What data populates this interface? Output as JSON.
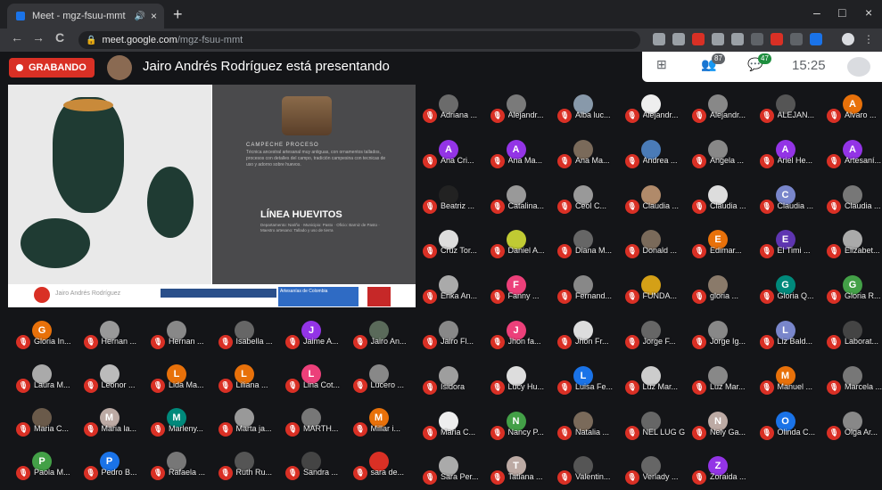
{
  "browser": {
    "tab_title": "Meet - mgz-fsuu-mmt",
    "tab_speaker": "🔊",
    "tab_close": "×",
    "new_tab": "+",
    "win_min": "–",
    "win_max": "□",
    "win_close": "×",
    "url_host": "meet.google.com",
    "url_path": "/mgz-fsuu-mmt",
    "nav_back": "←",
    "nav_forward": "→",
    "nav_reload": "C"
  },
  "meet": {
    "recording_label": "GRABANDO",
    "presenting_text": "Jairo Andrés Rodríguez está presentando",
    "participant_count": "87",
    "chat_count": "47",
    "time": "15:25",
    "grid_icon": "⊞",
    "people_icon": "👥",
    "chat_icon": "💬"
  },
  "slide": {
    "subtitle": "CAMPECHE PROCESO",
    "paragraph": "Técnica ancestral artesanal muy antiguas, con ornamentos tallados, procesos con detalles del campo, tradición campesina con tecnicas de uso y adorno sobre huevos.",
    "title": "LÍNEA HUEVITOS",
    "details": "Departamento: Nariño · Municipio: Pasto · Oficio: Barniz de Pasto · Maestro artesano: Tallado y uso de tierra",
    "footer_name": "Jairo Andrés Rodríguez",
    "footer_blue": "Artesanías de Colombia"
  },
  "participants_right": [
    {
      "name": "Adriana ...",
      "initial": "",
      "color": "#6b6b6b"
    },
    {
      "name": "Alejandr...",
      "initial": "",
      "color": "#7a7a7a"
    },
    {
      "name": "Alba luc...",
      "initial": "",
      "color": "#8899aa"
    },
    {
      "name": "Alejandr...",
      "initial": "",
      "color": "#eeeeee"
    },
    {
      "name": "Alejandr...",
      "initial": "",
      "color": "#888888"
    },
    {
      "name": "ALEJAN...",
      "initial": "",
      "color": "#555555"
    },
    {
      "name": "Alvaro ...",
      "initial": "A",
      "color": "#e8710a"
    },
    {
      "name": "Ana Cri...",
      "initial": "A",
      "color": "#9334e6"
    },
    {
      "name": "Ana Ma...",
      "initial": "A",
      "color": "#9334e6"
    },
    {
      "name": "Ana Ma...",
      "initial": "",
      "color": "#7a6a5a"
    },
    {
      "name": "Andrea ...",
      "initial": "",
      "color": "#4a7bb7"
    },
    {
      "name": "Angela ...",
      "initial": "",
      "color": "#888888"
    },
    {
      "name": "Ariel He...",
      "initial": "A",
      "color": "#9334e6"
    },
    {
      "name": "Artesaní...",
      "initial": "A",
      "color": "#9334e6"
    },
    {
      "name": "Beatriz ...",
      "initial": "",
      "color": "#222222"
    },
    {
      "name": "Catalina...",
      "initial": "",
      "color": "#999999"
    },
    {
      "name": "Ceol C...",
      "initial": "",
      "color": "#999999"
    },
    {
      "name": "Claudia ...",
      "initial": "",
      "color": "#b08a6a"
    },
    {
      "name": "Claudia ...",
      "initial": "",
      "color": "#dddddd"
    },
    {
      "name": "Claudia ...",
      "initial": "C",
      "color": "#7986cb"
    },
    {
      "name": "Claudia ...",
      "initial": "",
      "color": "#777777"
    },
    {
      "name": "Cruz Tor...",
      "initial": "",
      "color": "#dddddd"
    },
    {
      "name": "Daniel A...",
      "initial": "",
      "color": "#c0ca33"
    },
    {
      "name": "Diana M...",
      "initial": "",
      "color": "#666666"
    },
    {
      "name": "Donald ...",
      "initial": "",
      "color": "#7a6a5a"
    },
    {
      "name": "Edimar...",
      "initial": "E",
      "color": "#e8710a"
    },
    {
      "name": "El Timi ...",
      "initial": "E",
      "color": "#5e35b1"
    },
    {
      "name": "Elizabet...",
      "initial": "",
      "color": "#aaaaaa"
    },
    {
      "name": "Erika An...",
      "initial": "",
      "color": "#aaaaaa"
    },
    {
      "name": "Fanny ...",
      "initial": "F",
      "color": "#ec407a"
    },
    {
      "name": "Fernand...",
      "initial": "",
      "color": "#888888"
    },
    {
      "name": "FUNDA...",
      "initial": "",
      "color": "#d4a017"
    },
    {
      "name": "gloria ...",
      "initial": "",
      "color": "#8a7a6a"
    },
    {
      "name": "Gloria Q...",
      "initial": "G",
      "color": "#00897b"
    },
    {
      "name": "Gloria R...",
      "initial": "G",
      "color": "#43a047"
    },
    {
      "name": "Jairo Fl...",
      "initial": "",
      "color": "#888888"
    },
    {
      "name": "Jhon fa...",
      "initial": "J",
      "color": "#ec407a"
    },
    {
      "name": "Jhon Fr...",
      "initial": "",
      "color": "#dddddd"
    },
    {
      "name": "Jorge F...",
      "initial": "",
      "color": "#666666"
    },
    {
      "name": "Jorge Ig...",
      "initial": "",
      "color": "#888888"
    },
    {
      "name": "Liz Bald...",
      "initial": "L",
      "color": "#7986cb"
    },
    {
      "name": "Laborat...",
      "initial": "",
      "color": "#444444"
    },
    {
      "name": "Isidora",
      "initial": "",
      "color": "#9e9e9e"
    },
    {
      "name": "Lucy Hu...",
      "initial": "",
      "color": "#dddddd"
    },
    {
      "name": "Luisa Fe...",
      "initial": "L",
      "color": "#1a73e8"
    },
    {
      "name": "Luz Mar...",
      "initial": "",
      "color": "#cccccc"
    },
    {
      "name": "Luz Mar...",
      "initial": "",
      "color": "#888888"
    },
    {
      "name": "Manuel ...",
      "initial": "M",
      "color": "#e8710a"
    },
    {
      "name": "Marcela ...",
      "initial": "",
      "color": "#777777"
    },
    {
      "name": "Maria C...",
      "initial": "",
      "color": "#eeeeee"
    },
    {
      "name": "Nancy P...",
      "initial": "N",
      "color": "#43a047"
    },
    {
      "name": "Natalia ...",
      "initial": "",
      "color": "#7a6a5a"
    },
    {
      "name": "NEL LUG G",
      "initial": "",
      "color": "#666666"
    },
    {
      "name": "Nely Ga...",
      "initial": "N",
      "color": "#bcaaa4"
    },
    {
      "name": "Olinda C...",
      "initial": "O",
      "color": "#1a73e8"
    },
    {
      "name": "Olga Ar...",
      "initial": "",
      "color": "#888888"
    },
    {
      "name": "Sara Per...",
      "initial": "",
      "color": "#aaaaaa"
    },
    {
      "name": "Tatiana ...",
      "initial": "T",
      "color": "#bcaaa4"
    },
    {
      "name": "Valentin...",
      "initial": "",
      "color": "#555555"
    },
    {
      "name": "Verlady ...",
      "initial": "",
      "color": "#666666"
    },
    {
      "name": "Zoraida ...",
      "initial": "Z",
      "color": "#9334e6"
    }
  ],
  "participants_bottom": [
    {
      "name": "Gloria In...",
      "initial": "G",
      "color": "#e8710a"
    },
    {
      "name": "Hernan ...",
      "initial": "",
      "color": "#999999"
    },
    {
      "name": "Hernan ...",
      "initial": "",
      "color": "#888888"
    },
    {
      "name": "Isabella ...",
      "initial": "",
      "color": "#666666"
    },
    {
      "name": "Jaime A...",
      "initial": "J",
      "color": "#9334e6"
    },
    {
      "name": "Jairo An...",
      "initial": "",
      "color": "#5a6a5a"
    },
    {
      "name": "Laura M...",
      "initial": "",
      "color": "#aaaaaa"
    },
    {
      "name": "Leonor ...",
      "initial": "",
      "color": "#bbbbbb"
    },
    {
      "name": "Lida Ma...",
      "initial": "L",
      "color": "#e8710a"
    },
    {
      "name": "Liliana ...",
      "initial": "L",
      "color": "#e8710a"
    },
    {
      "name": "Lina Cot...",
      "initial": "L",
      "color": "#ec407a"
    },
    {
      "name": "Lucero ...",
      "initial": "",
      "color": "#888888"
    },
    {
      "name": "Maria C...",
      "initial": "",
      "color": "#6a5a4a"
    },
    {
      "name": "Maria la...",
      "initial": "M",
      "color": "#bcaaa4"
    },
    {
      "name": "Marleny...",
      "initial": "M",
      "color": "#00897b"
    },
    {
      "name": "Marta ja...",
      "initial": "",
      "color": "#999999"
    },
    {
      "name": "MARTH...",
      "initial": "",
      "color": "#777777"
    },
    {
      "name": "Millar i...",
      "initial": "M",
      "color": "#e8710a"
    },
    {
      "name": "Paola M...",
      "initial": "P",
      "color": "#43a047"
    },
    {
      "name": "Pedro B...",
      "initial": "P",
      "color": "#1a73e8"
    },
    {
      "name": "Rafaela ...",
      "initial": "",
      "color": "#777777"
    },
    {
      "name": "Ruth Ru...",
      "initial": "",
      "color": "#555555"
    },
    {
      "name": "Sandra ...",
      "initial": "",
      "color": "#444444"
    },
    {
      "name": "sara de...",
      "initial": "",
      "color": "#d93025"
    }
  ]
}
